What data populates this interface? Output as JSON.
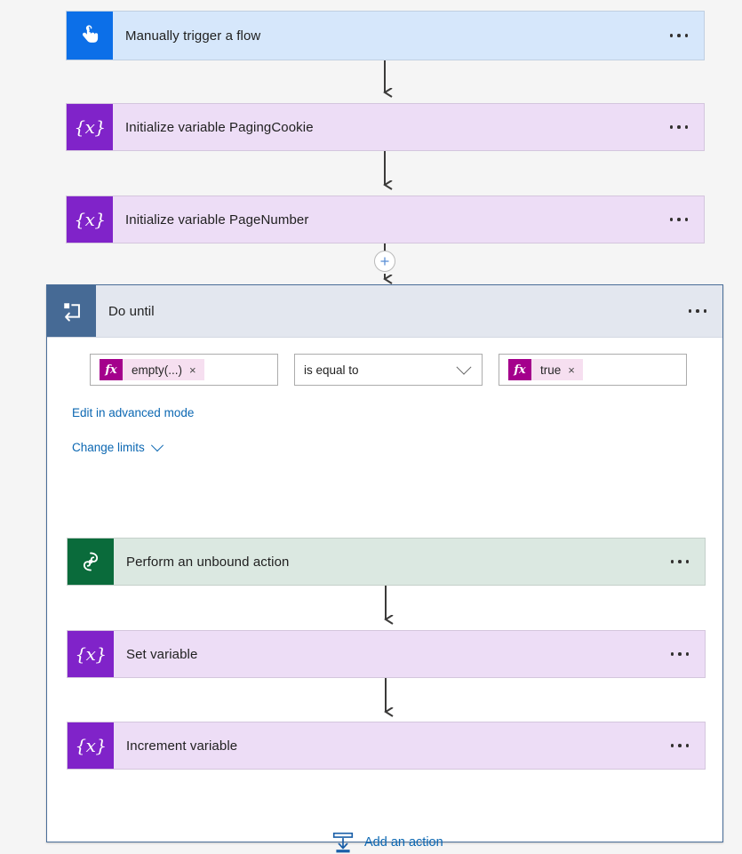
{
  "flow": {
    "steps": [
      {
        "id": "trigger",
        "title": "Manually trigger a flow",
        "icon": "manual-trigger-icon",
        "type": "trigger",
        "accent": "#0C6FE8",
        "background": "#D6E7FB",
        "menu_label": "..."
      },
      {
        "id": "init-paging-cookie",
        "title": "Initialize variable PagingCookie",
        "icon": "variable-icon",
        "type": "variable",
        "accent": "#8023C9",
        "background": "#EDDDF6",
        "menu_label": "..."
      },
      {
        "id": "init-page-number",
        "title": "Initialize variable PageNumber",
        "icon": "variable-icon",
        "type": "variable",
        "accent": "#8023C9",
        "background": "#EDDDF6",
        "menu_label": "..."
      }
    ],
    "insert_button_label": "+"
  },
  "do_until": {
    "title": "Do until",
    "icon": "loop-icon",
    "accent": "#466A95",
    "header_background": "#E3E7EF",
    "border_color": "#4A6E99",
    "menu_label": "...",
    "condition": {
      "left_token": {
        "fx_label": "fx",
        "text": "empty(...)",
        "remove_label": "×"
      },
      "operator": "is equal to",
      "right_token": {
        "fx_label": "fx",
        "text": "true",
        "remove_label": "×"
      }
    },
    "advanced_mode_link": "Edit in advanced mode",
    "change_limits_link": "Change limits",
    "steps": [
      {
        "id": "perform-unbound-action",
        "title": "Perform an unbound action",
        "icon": "dataverse-icon",
        "type": "dataverse",
        "accent": "#0A6B3B",
        "background": "#DBE8E1",
        "menu_label": "..."
      },
      {
        "id": "set-variable",
        "title": "Set variable",
        "icon": "variable-icon",
        "type": "variable",
        "accent": "#8023C9",
        "background": "#EDDDF6",
        "menu_label": "..."
      },
      {
        "id": "increment-variable",
        "title": "Increment variable",
        "icon": "variable-icon",
        "type": "variable",
        "accent": "#8023C9",
        "background": "#EDDDF6",
        "menu_label": "..."
      }
    ],
    "add_action_label": "Add an action",
    "add_action_icon": "insert-action-icon"
  }
}
